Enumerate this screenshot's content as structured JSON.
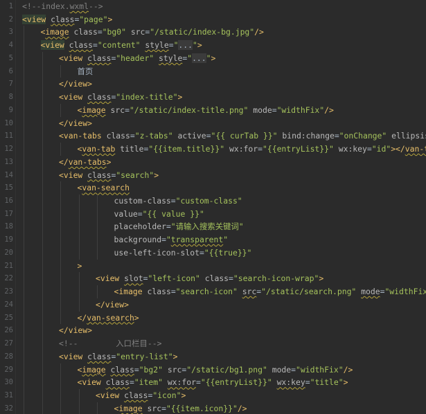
{
  "editor": {
    "file_comment": "index.wxml",
    "lines": [
      {
        "n": "1",
        "indent": 0,
        "tokens": [
          {
            "t": "<!--index.",
            "c": "comment"
          },
          {
            "t": "wxml",
            "c": "comment",
            "u": true
          },
          {
            "t": "-->",
            "c": "comment"
          }
        ]
      },
      {
        "n": "2",
        "indent": 0,
        "tokens": [
          {
            "t": "<view",
            "c": "tag",
            "hl": true
          },
          {
            "t": " ",
            "c": "text"
          },
          {
            "t": "class",
            "c": "attr",
            "u": true
          },
          {
            "t": "=",
            "c": "eq"
          },
          {
            "t": "\"page\"",
            "c": "string"
          },
          {
            "t": ">",
            "c": "tag"
          }
        ]
      },
      {
        "n": "3",
        "indent": 1,
        "tokens": [
          {
            "t": "<",
            "c": "tag"
          },
          {
            "t": "image",
            "c": "tag",
            "u": true
          },
          {
            "t": " ",
            "c": "text"
          },
          {
            "t": "class",
            "c": "attr"
          },
          {
            "t": "=",
            "c": "eq"
          },
          {
            "t": "\"bg0\"",
            "c": "string"
          },
          {
            "t": " ",
            "c": "text"
          },
          {
            "t": "src",
            "c": "attr"
          },
          {
            "t": "=",
            "c": "eq"
          },
          {
            "t": "\"/static/index-bg.jpg\"",
            "c": "string"
          },
          {
            "t": "/>",
            "c": "tag"
          }
        ]
      },
      {
        "n": "4",
        "indent": 1,
        "tokens": [
          {
            "t": "<view",
            "c": "tag",
            "hl": true
          },
          {
            "t": " ",
            "c": "text"
          },
          {
            "t": "class",
            "c": "attr",
            "u": true
          },
          {
            "t": "=",
            "c": "eq"
          },
          {
            "t": "\"content\"",
            "c": "string"
          },
          {
            "t": " ",
            "c": "text"
          },
          {
            "t": "style",
            "c": "attr",
            "u": true
          },
          {
            "t": "=",
            "c": "eq"
          },
          {
            "t": "\"",
            "c": "string"
          },
          {
            "t": "...",
            "c": "fold"
          },
          {
            "t": "\"",
            "c": "string"
          },
          {
            "t": ">",
            "c": "tag"
          }
        ]
      },
      {
        "n": "5",
        "indent": 2,
        "tokens": [
          {
            "t": "<view",
            "c": "tag"
          },
          {
            "t": " ",
            "c": "text"
          },
          {
            "t": "class",
            "c": "attr",
            "u": true
          },
          {
            "t": "=",
            "c": "eq"
          },
          {
            "t": "\"header\"",
            "c": "string"
          },
          {
            "t": " ",
            "c": "text"
          },
          {
            "t": "style",
            "c": "attr",
            "u": true
          },
          {
            "t": "=",
            "c": "eq"
          },
          {
            "t": "\"",
            "c": "string"
          },
          {
            "t": "...",
            "c": "fold"
          },
          {
            "t": "\"",
            "c": "string"
          },
          {
            "t": ">",
            "c": "tag"
          }
        ]
      },
      {
        "n": "6",
        "indent": 3,
        "tokens": [
          {
            "t": "首页",
            "c": "text"
          }
        ]
      },
      {
        "n": "7",
        "indent": 2,
        "tokens": [
          {
            "t": "</view>",
            "c": "tag"
          }
        ]
      },
      {
        "n": "8",
        "indent": 2,
        "tokens": [
          {
            "t": "<view",
            "c": "tag"
          },
          {
            "t": " ",
            "c": "text"
          },
          {
            "t": "class",
            "c": "attr",
            "u": true
          },
          {
            "t": "=",
            "c": "eq"
          },
          {
            "t": "\"index-title\"",
            "c": "string"
          },
          {
            "t": ">",
            "c": "tag"
          }
        ]
      },
      {
        "n": "9",
        "indent": 3,
        "tokens": [
          {
            "t": "<",
            "c": "tag"
          },
          {
            "t": "image",
            "c": "tag",
            "u": true
          },
          {
            "t": " ",
            "c": "text"
          },
          {
            "t": "src",
            "c": "attr"
          },
          {
            "t": "=",
            "c": "eq"
          },
          {
            "t": "\"/static/index-title.png\"",
            "c": "string"
          },
          {
            "t": " ",
            "c": "text"
          },
          {
            "t": "mode",
            "c": "attr"
          },
          {
            "t": "=",
            "c": "eq"
          },
          {
            "t": "\"widthFix\"",
            "c": "string"
          },
          {
            "t": "/>",
            "c": "tag"
          }
        ]
      },
      {
        "n": "10",
        "indent": 2,
        "tokens": [
          {
            "t": "</view>",
            "c": "tag"
          }
        ]
      },
      {
        "n": "11",
        "indent": 2,
        "tokens": [
          {
            "t": "<van-tabs",
            "c": "tag"
          },
          {
            "t": " ",
            "c": "text"
          },
          {
            "t": "class",
            "c": "attr"
          },
          {
            "t": "=",
            "c": "eq"
          },
          {
            "t": "\"z-tabs\"",
            "c": "string"
          },
          {
            "t": " ",
            "c": "text"
          },
          {
            "t": "active",
            "c": "attr"
          },
          {
            "t": "=",
            "c": "eq"
          },
          {
            "t": "\"{{ curTab }}\"",
            "c": "string"
          },
          {
            "t": " ",
            "c": "text"
          },
          {
            "t": "bind:change",
            "c": "attr"
          },
          {
            "t": "=",
            "c": "eq"
          },
          {
            "t": "\"onChange\"",
            "c": "string"
          },
          {
            "t": " ",
            "c": "text"
          },
          {
            "t": "ellipsis",
            "c": "attr"
          },
          {
            "t": "=",
            "c": "eq"
          },
          {
            "t": "\"{{",
            "c": "string"
          }
        ]
      },
      {
        "n": "12",
        "indent": 3,
        "tokens": [
          {
            "t": "<",
            "c": "tag"
          },
          {
            "t": "van-tab",
            "c": "tag",
            "u": true
          },
          {
            "t": " ",
            "c": "text"
          },
          {
            "t": "title",
            "c": "attr"
          },
          {
            "t": "=",
            "c": "eq"
          },
          {
            "t": "\"{{item.title}}\"",
            "c": "string"
          },
          {
            "t": " ",
            "c": "text"
          },
          {
            "t": "wx:for",
            "c": "attr"
          },
          {
            "t": "=",
            "c": "eq"
          },
          {
            "t": "\"{{entryList}}\"",
            "c": "string"
          },
          {
            "t": " ",
            "c": "text"
          },
          {
            "t": "wx:key",
            "c": "attr"
          },
          {
            "t": "=",
            "c": "eq"
          },
          {
            "t": "\"id\"",
            "c": "string"
          },
          {
            "t": "></",
            "c": "tag"
          },
          {
            "t": "van-tab",
            "c": "tag",
            "u": true
          },
          {
            "t": ">",
            "c": "tag"
          }
        ]
      },
      {
        "n": "13",
        "indent": 2,
        "tokens": [
          {
            "t": "</",
            "c": "tag"
          },
          {
            "t": "van-tabs",
            "c": "tag",
            "u": true
          },
          {
            "t": ">",
            "c": "tag"
          }
        ]
      },
      {
        "n": "14",
        "indent": 2,
        "tokens": [
          {
            "t": "<view",
            "c": "tag"
          },
          {
            "t": " ",
            "c": "text"
          },
          {
            "t": "class",
            "c": "attr",
            "u": true
          },
          {
            "t": "=",
            "c": "eq"
          },
          {
            "t": "\"search\"",
            "c": "string"
          },
          {
            "t": ">",
            "c": "tag"
          }
        ]
      },
      {
        "n": "15",
        "indent": 3,
        "tokens": [
          {
            "t": "<",
            "c": "tag"
          },
          {
            "t": "van-search",
            "c": "tag",
            "u": true
          }
        ]
      },
      {
        "n": "16",
        "indent": 5,
        "tokens": [
          {
            "t": "custom-class",
            "c": "attr"
          },
          {
            "t": "=",
            "c": "eq"
          },
          {
            "t": "\"custom-class\"",
            "c": "string"
          }
        ]
      },
      {
        "n": "17",
        "indent": 5,
        "tokens": [
          {
            "t": "value",
            "c": "attr"
          },
          {
            "t": "=",
            "c": "eq"
          },
          {
            "t": "\"{{ value }}\"",
            "c": "string"
          }
        ]
      },
      {
        "n": "18",
        "indent": 5,
        "tokens": [
          {
            "t": "placeholder",
            "c": "attr"
          },
          {
            "t": "=",
            "c": "eq"
          },
          {
            "t": "\"请输入搜索关键词\"",
            "c": "string"
          }
        ]
      },
      {
        "n": "19",
        "indent": 5,
        "tokens": [
          {
            "t": "background",
            "c": "attr"
          },
          {
            "t": "=",
            "c": "eq"
          },
          {
            "t": "\"",
            "c": "string"
          },
          {
            "t": "transparent",
            "c": "string",
            "u": true
          },
          {
            "t": "\"",
            "c": "string"
          }
        ]
      },
      {
        "n": "20",
        "indent": 5,
        "tokens": [
          {
            "t": "use-left-icon-slot",
            "c": "attr"
          },
          {
            "t": "=",
            "c": "eq"
          },
          {
            "t": "\"{{true}}\"",
            "c": "string"
          }
        ]
      },
      {
        "n": "21",
        "indent": 3,
        "tokens": [
          {
            "t": ">",
            "c": "tag"
          }
        ]
      },
      {
        "n": "22",
        "indent": 4,
        "tokens": [
          {
            "t": "<view",
            "c": "tag"
          },
          {
            "t": " ",
            "c": "text"
          },
          {
            "t": "slot",
            "c": "attr",
            "u": true
          },
          {
            "t": "=",
            "c": "eq"
          },
          {
            "t": "\"left-icon\"",
            "c": "string"
          },
          {
            "t": " ",
            "c": "text"
          },
          {
            "t": "class",
            "c": "attr"
          },
          {
            "t": "=",
            "c": "eq"
          },
          {
            "t": "\"search-icon-wrap\"",
            "c": "string"
          },
          {
            "t": ">",
            "c": "tag"
          }
        ]
      },
      {
        "n": "23",
        "indent": 5,
        "tokens": [
          {
            "t": "<image",
            "c": "tag"
          },
          {
            "t": " ",
            "c": "text"
          },
          {
            "t": "class",
            "c": "attr"
          },
          {
            "t": "=",
            "c": "eq"
          },
          {
            "t": "\"search-icon\"",
            "c": "string"
          },
          {
            "t": " ",
            "c": "text"
          },
          {
            "t": "src",
            "c": "attr",
            "u": true
          },
          {
            "t": "=",
            "c": "eq"
          },
          {
            "t": "\"/static/search.png\"",
            "c": "string"
          },
          {
            "t": " ",
            "c": "text"
          },
          {
            "t": "mode",
            "c": "attr",
            "u": true
          },
          {
            "t": "=",
            "c": "eq"
          },
          {
            "t": "\"widthFix\"",
            "c": "string"
          },
          {
            "t": "></",
            "c": "tag"
          }
        ]
      },
      {
        "n": "24",
        "indent": 4,
        "tokens": [
          {
            "t": "</view>",
            "c": "tag"
          }
        ]
      },
      {
        "n": "25",
        "indent": 3,
        "tokens": [
          {
            "t": "</",
            "c": "tag"
          },
          {
            "t": "van-search",
            "c": "tag",
            "u": true
          },
          {
            "t": ">",
            "c": "tag"
          }
        ]
      },
      {
        "n": "26",
        "indent": 2,
        "tokens": [
          {
            "t": "</view>",
            "c": "tag"
          }
        ]
      },
      {
        "n": "27",
        "indent": 2,
        "tokens": [
          {
            "t": "<!--        入口栏目-->",
            "c": "comment"
          }
        ]
      },
      {
        "n": "28",
        "indent": 2,
        "tokens": [
          {
            "t": "<view",
            "c": "tag"
          },
          {
            "t": " ",
            "c": "text"
          },
          {
            "t": "class",
            "c": "attr",
            "u": true
          },
          {
            "t": "=",
            "c": "eq"
          },
          {
            "t": "\"entry-list\"",
            "c": "string"
          },
          {
            "t": ">",
            "c": "tag"
          }
        ]
      },
      {
        "n": "29",
        "indent": 3,
        "tokens": [
          {
            "t": "<",
            "c": "tag"
          },
          {
            "t": "image",
            "c": "tag",
            "u": true
          },
          {
            "t": " ",
            "c": "text"
          },
          {
            "t": "class",
            "c": "attr",
            "u": true
          },
          {
            "t": "=",
            "c": "eq"
          },
          {
            "t": "\"bg2\"",
            "c": "string"
          },
          {
            "t": " ",
            "c": "text"
          },
          {
            "t": "src",
            "c": "attr"
          },
          {
            "t": "=",
            "c": "eq"
          },
          {
            "t": "\"/static/bg1.png\"",
            "c": "string"
          },
          {
            "t": " ",
            "c": "text"
          },
          {
            "t": "mode",
            "c": "attr"
          },
          {
            "t": "=",
            "c": "eq"
          },
          {
            "t": "\"widthFix\"",
            "c": "string"
          },
          {
            "t": "/>",
            "c": "tag"
          }
        ]
      },
      {
        "n": "30",
        "indent": 3,
        "tokens": [
          {
            "t": "<view",
            "c": "tag"
          },
          {
            "t": " ",
            "c": "text"
          },
          {
            "t": "class",
            "c": "attr",
            "u": true
          },
          {
            "t": "=",
            "c": "eq"
          },
          {
            "t": "\"item\"",
            "c": "string"
          },
          {
            "t": " ",
            "c": "text"
          },
          {
            "t": "wx:for",
            "c": "attr",
            "u": true
          },
          {
            "t": "=",
            "c": "eq"
          },
          {
            "t": "\"{{entryList}}\"",
            "c": "string"
          },
          {
            "t": " ",
            "c": "text"
          },
          {
            "t": "wx:key",
            "c": "attr",
            "u": true
          },
          {
            "t": "=",
            "c": "eq"
          },
          {
            "t": "\"title\"",
            "c": "string"
          },
          {
            "t": ">",
            "c": "tag"
          }
        ]
      },
      {
        "n": "31",
        "indent": 4,
        "tokens": [
          {
            "t": "<view",
            "c": "tag"
          },
          {
            "t": " ",
            "c": "text"
          },
          {
            "t": "class",
            "c": "attr",
            "u": true
          },
          {
            "t": "=",
            "c": "eq"
          },
          {
            "t": "\"icon\"",
            "c": "string"
          },
          {
            "t": ">",
            "c": "tag"
          }
        ]
      },
      {
        "n": "32",
        "indent": 5,
        "tokens": [
          {
            "t": "<",
            "c": "tag"
          },
          {
            "t": "image",
            "c": "tag",
            "u": true
          },
          {
            "t": " ",
            "c": "text"
          },
          {
            "t": "src",
            "c": "attr"
          },
          {
            "t": "=",
            "c": "eq"
          },
          {
            "t": "\"{{item.icon}}\"",
            "c": "string"
          },
          {
            "t": "/>",
            "c": "tag"
          }
        ]
      }
    ]
  },
  "colors": {
    "background": "#2b2b2b",
    "line_numbers": "#606366",
    "comment": "#808080",
    "tag": "#e8bf6a",
    "attribute": "#bababa",
    "string": "#a5c25c",
    "text": "#a9b7c6"
  }
}
